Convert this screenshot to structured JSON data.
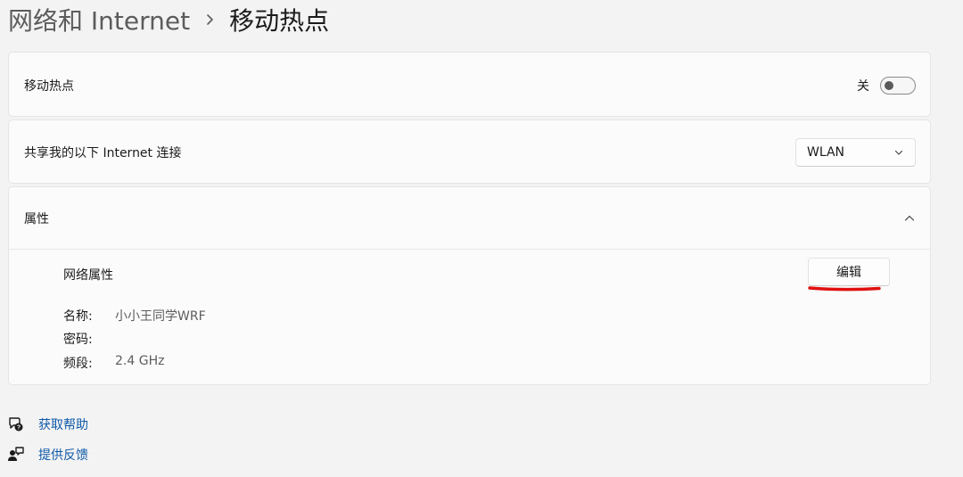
{
  "breadcrumb": {
    "parent": "网络和 Internet",
    "separator": "›",
    "current": "移动热点"
  },
  "hotspot": {
    "label": "移动热点",
    "toggle_state_text": "关",
    "enabled": false
  },
  "sharing": {
    "label": "共享我的以下 Internet 连接",
    "selected": "WLAN"
  },
  "properties": {
    "header": "属性",
    "expanded": true,
    "network_properties_label": "网络属性",
    "edit_label": "编辑",
    "items": [
      {
        "key": "名称:",
        "value": "小小王同学WRF"
      },
      {
        "key": "密码:",
        "value": ""
      },
      {
        "key": "频段:",
        "value": "2.4 GHz"
      }
    ]
  },
  "footer_links": {
    "help": "获取帮助",
    "feedback": "提供反馈"
  },
  "colors": {
    "link": "#0f5aa8",
    "annotation": "#e01010"
  },
  "icons": {
    "help": "help-chat-icon",
    "feedback": "feedback-person-icon",
    "select_chevron": "chevron-down-icon",
    "expand_chevron": "chevron-up-icon"
  }
}
